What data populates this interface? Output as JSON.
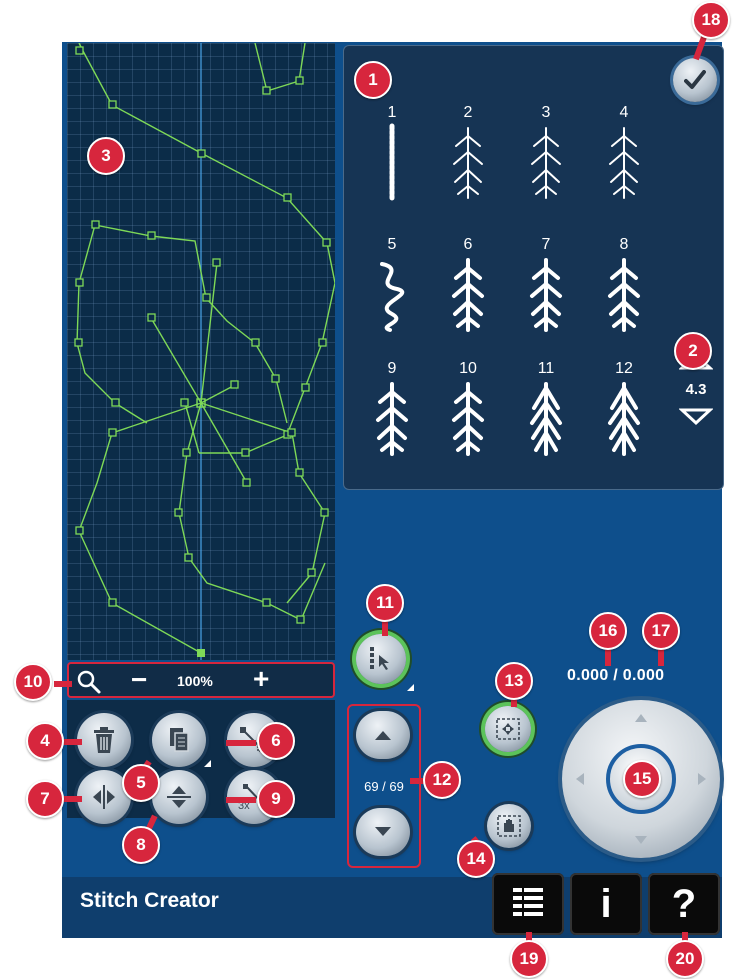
{
  "app": {
    "title": "Stitch Creator"
  },
  "colors": {
    "screen_bg": "#0e4f8c",
    "panel_bg": "#163454",
    "canvas_bg": "#0b2c48",
    "stitch_line": "#7ed957",
    "callout": "#d7263d",
    "active_ring": "#5cc35a"
  },
  "zoom": {
    "minus": "−",
    "value": "100%",
    "plus": "+",
    "icon": "magnifier-icon"
  },
  "tools": [
    {
      "name": "delete-button",
      "icon": "trash-icon"
    },
    {
      "name": "duplicate-button",
      "icon": "copy-icon"
    },
    {
      "name": "insert-point-button",
      "icon": "insert-point-icon"
    },
    {
      "name": "mirror-horizontal-button",
      "icon": "mirror-side-icon"
    },
    {
      "name": "mirror-vertical-button",
      "icon": "mirror-up-down-icon"
    },
    {
      "name": "triple-stitch-button",
      "icon": "triple-stitch-icon",
      "label": "3x"
    }
  ],
  "stitches": [
    {
      "num": "1"
    },
    {
      "num": "2"
    },
    {
      "num": "3"
    },
    {
      "num": "4"
    },
    {
      "num": "5"
    },
    {
      "num": "6"
    },
    {
      "num": "7"
    },
    {
      "num": "8"
    },
    {
      "num": "9"
    },
    {
      "num": "10"
    },
    {
      "num": "11"
    },
    {
      "num": "12"
    }
  ],
  "stitch_scroll": {
    "value": "4.3",
    "up": "△",
    "down": "▽"
  },
  "point_nav": {
    "count": "69 / 69"
  },
  "coordinates": {
    "x": "0.000",
    "y": "0.000",
    "separator": "/"
  },
  "callouts": [
    "1",
    "2",
    "3",
    "4",
    "5",
    "6",
    "7",
    "8",
    "9",
    "10",
    "11",
    "12",
    "13",
    "14",
    "15",
    "16",
    "17",
    "18",
    "19",
    "20"
  ],
  "bottom_buttons": {
    "menu_icon": "list-icon",
    "info": "i",
    "help": "?"
  }
}
